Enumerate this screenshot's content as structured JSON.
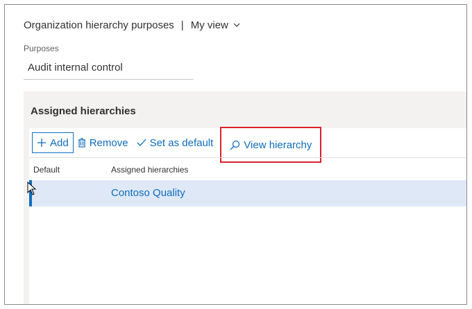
{
  "header": {
    "title": "Organization hierarchy purposes",
    "separator": "|",
    "view_label": "My view"
  },
  "purposes": {
    "label": "Purposes",
    "value": "Audit internal control"
  },
  "assigned": {
    "title": "Assigned hierarchies",
    "toolbar": {
      "add": "Add",
      "remove": "Remove",
      "set_default": "Set as default",
      "view_hierarchy": "View hierarchy"
    },
    "columns": [
      "Default",
      "Assigned hierarchies"
    ],
    "rows": [
      {
        "default": "",
        "hierarchy": "Contoso Quality"
      }
    ]
  },
  "colors": {
    "accent": "#0f6cbd",
    "highlight_box": "#d9212c",
    "selected_row": "#dee8f7"
  }
}
